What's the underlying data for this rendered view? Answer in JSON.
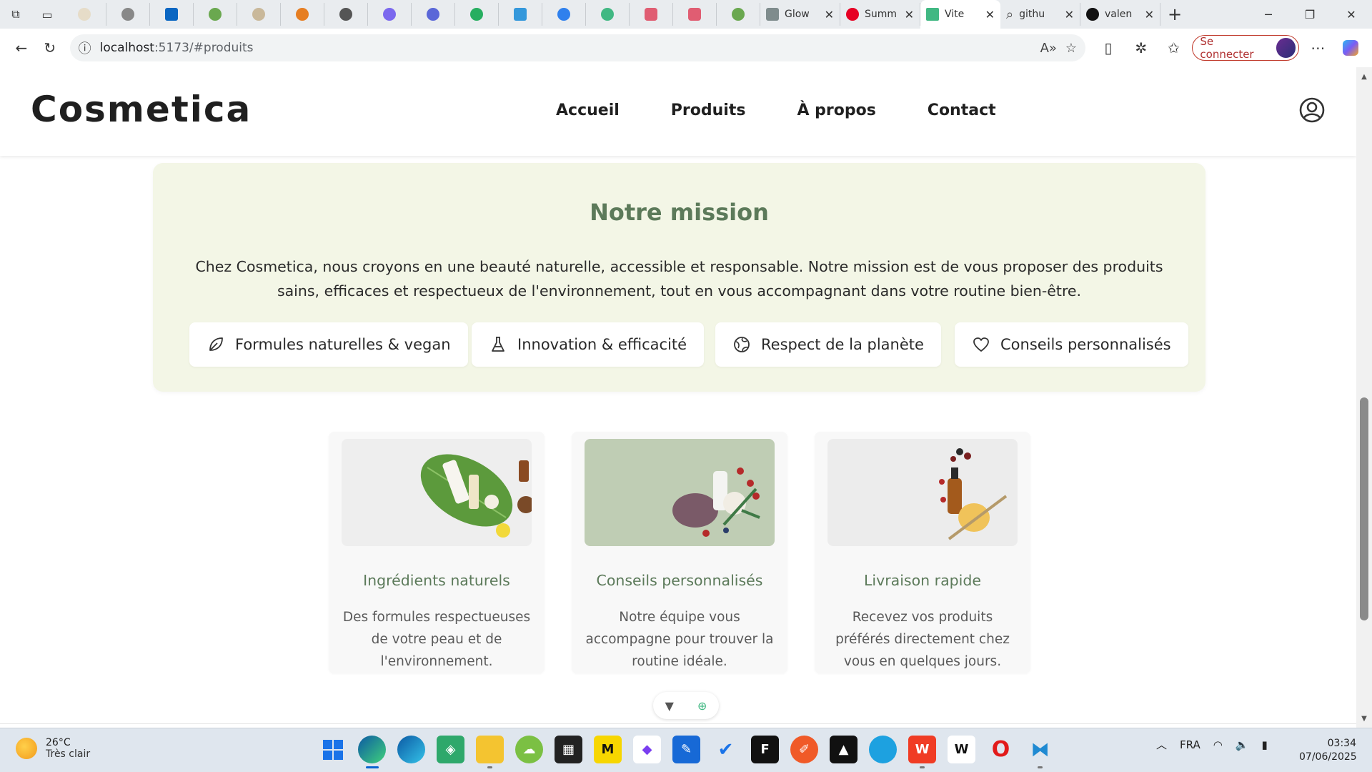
{
  "browser": {
    "tabs": [
      {
        "label": "Glow",
        "favicon_color": "#7f8c8d"
      },
      {
        "label": "Summ",
        "favicon_color": "#e60023"
      },
      {
        "label": "Vite",
        "favicon_color": "#41b883",
        "active": true
      },
      {
        "label": "githu",
        "favicon_color": "#5f6368"
      },
      {
        "label": "valen",
        "favicon_color": "#111111"
      }
    ],
    "url_host": "localhost",
    "url_path": ":5173/#produits",
    "signin_label": "Se connecter"
  },
  "site": {
    "logo": "Cosmetica",
    "nav": [
      "Accueil",
      "Produits",
      "À propos",
      "Contact"
    ],
    "mission": {
      "title": "Notre mission",
      "text": "Chez Cosmetica, nous croyons en une beauté naturelle, accessible et responsable. Notre mission est de vous proposer des produits sains, efficaces et respectueux de l'environnement, tout en vous accompagnant dans votre routine bien-être.",
      "values": [
        {
          "label": "Formules naturelles & vegan",
          "icon": "leaf-icon"
        },
        {
          "label": "Innovation & efficacité",
          "icon": "flask-icon"
        },
        {
          "label": "Respect de la planète",
          "icon": "globe-icon"
        },
        {
          "label": "Conseils personnalisés",
          "icon": "heart-icon"
        }
      ]
    },
    "features": [
      {
        "title": "Ingrédients naturels",
        "description": "Des formules respectueuses de votre peau et de l'environnement."
      },
      {
        "title": "Conseils personnalisés",
        "description": "Notre équipe vous accompagne pour trouver la routine idéale."
      },
      {
        "title": "Livraison rapide",
        "description": "Recevez vos produits préférés directement chez vous en quelques jours."
      }
    ],
    "colors": {
      "mission_bg": "#f3f6e6",
      "accent_green": "#5c7a5a"
    }
  },
  "taskbar": {
    "weather_temp": "26°C",
    "weather_desc": "Très clair",
    "language": "FRA",
    "time": "03:34",
    "date": "07/06/2025"
  }
}
